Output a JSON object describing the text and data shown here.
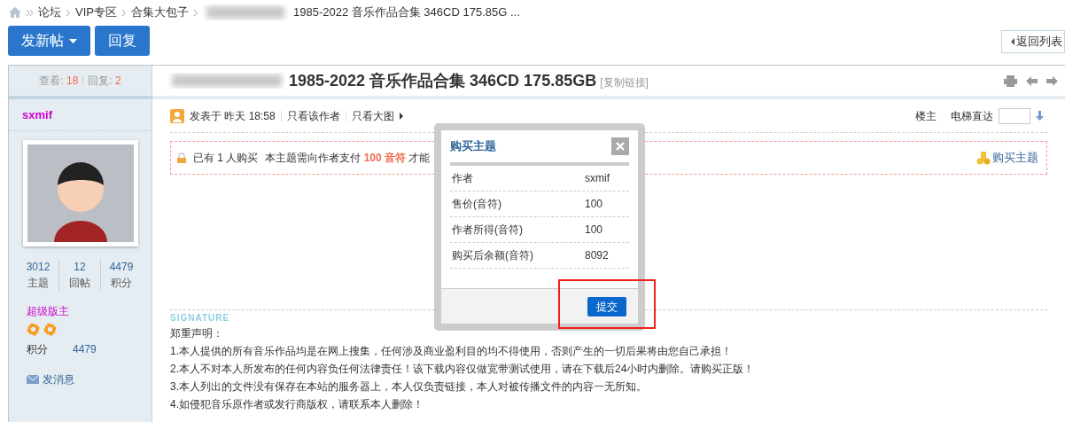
{
  "breadcrumb": {
    "items": [
      "论坛",
      "VIP专区",
      "合集大包子"
    ],
    "current": "1985-2022 音乐作品合集 346CD 175.85G ..."
  },
  "toolbar": {
    "buttons": [
      {
        "label": "发新帖",
        "kind": "dropdown"
      },
      {
        "label": "回复",
        "kind": "plain"
      }
    ],
    "back": "返回列表"
  },
  "stats": {
    "views_label": "查看:",
    "views": "18",
    "replies_label": "回复:",
    "replies": "2"
  },
  "thread": {
    "title": "1985-2022 音乐作品合集 346CD 175.85GB",
    "copy_link": "[复制链接]"
  },
  "author": {
    "name": "sxmif",
    "counts": [
      {
        "value": "3012",
        "label": "主题"
      },
      {
        "value": "12",
        "label": "回帖"
      },
      {
        "value": "4479",
        "label": "积分"
      }
    ],
    "group": "超级版主",
    "points_label": "积分",
    "points": "4479",
    "message": "发消息"
  },
  "post": {
    "posted": "发表于 昨天 18:58",
    "links": [
      "只看该作者",
      "只看大图"
    ],
    "floor": "楼主",
    "jump_label": "电梯直达"
  },
  "purchase": {
    "bought": "已有 1 人购买",
    "prefix": "本主题需向作者支付",
    "price": "100 音符",
    "suffix": "才能",
    "buy": "购买主题"
  },
  "signature": {
    "heading": "SIGNATURE",
    "lines": [
      "郑重声明：",
      "1.本人提供的所有音乐作品均是在网上搜集，任何涉及商业盈利目的均不得使用，否则产生的一切后果将由您自己承担！",
      "2.本人不对本人所发布的任何内容负任何法律责任！该下载内容仅做宽带测试使用，请在下载后24小时内删除。请购买正版！",
      "3.本人列出的文件没有保存在本站的服务器上，本人仅负责链接，本人对被传播文件的内容一无所知。",
      "4.如侵犯音乐原作者或发行商版权，请联系本人删除！"
    ]
  },
  "dialog": {
    "title": "购买主题",
    "rows": [
      {
        "label": "作者",
        "value": "sxmif"
      },
      {
        "label": "售价(音符)",
        "value": "100"
      },
      {
        "label": "作者所得(音符)",
        "value": "100"
      },
      {
        "label": "购买后余额(音符)",
        "value": "8092"
      }
    ],
    "submit": "提交"
  }
}
